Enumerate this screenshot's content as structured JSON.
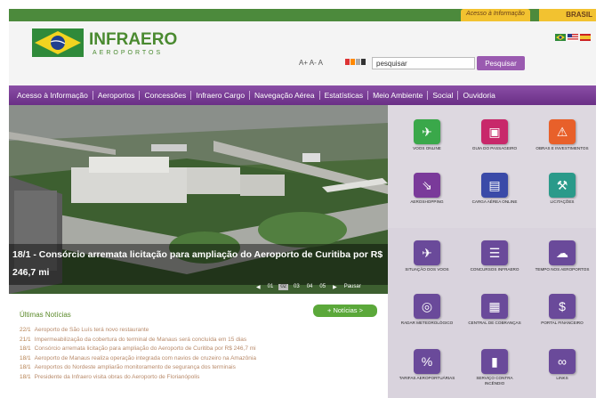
{
  "topbar": {
    "acesso_label": "Acesso à Informação",
    "brasil_label": "BRASIL"
  },
  "logo": {
    "name": "INFRAERO",
    "sub": "AEROPORTOS"
  },
  "font_controls": "A+ A- A",
  "search": {
    "value": "pesquisar",
    "button_label": "Pesquisar"
  },
  "nav": {
    "items": [
      "Acesso à Informação",
      "Aeroportos",
      "Concessões",
      "Infraero Cargo",
      "Navegação Aérea",
      "Estatísticas",
      "Meio Ambiente",
      "Social",
      "Ouvidoria"
    ]
  },
  "hero": {
    "caption": "18/1 - Consórcio arremata licitação para ampliação do Aeroporto de Curitiba por R$ 246,7 mi",
    "pager": [
      "01",
      "02",
      "03",
      "04",
      "05",
      "Pausar"
    ]
  },
  "tiles": [
    {
      "label": "Voos Online",
      "icon": "plane-icon",
      "color": "#3aa84a"
    },
    {
      "label": "Guia do Passageiro",
      "icon": "suitcase-icon",
      "color": "#c8286a"
    },
    {
      "label": "Obras e Investimentos",
      "icon": "construction-icon",
      "color": "#e8602a"
    },
    {
      "label": "Aeroshopping",
      "icon": "shopping-icon",
      "color": "#7a3a9a"
    },
    {
      "label": "Carga Aérea Online",
      "icon": "cart-icon",
      "color": "#3a4aa8"
    },
    {
      "label": "Licitações",
      "icon": "gavel-icon",
      "color": "#2a9a8a"
    },
    {
      "label": "Situação dos Voos",
      "icon": "plane-status-icon",
      "color": "#6a4a9a"
    },
    {
      "label": "Concursos Infraero",
      "icon": "document-icon",
      "color": "#6a4a9a"
    },
    {
      "label": "Tempo nos Aeroportos",
      "icon": "weather-icon",
      "color": "#6a4a9a"
    },
    {
      "label": "Radar Meteorológico",
      "icon": "radar-icon",
      "color": "#6a4a9a"
    },
    {
      "label": "Central de Cobranças",
      "icon": "money-icon",
      "color": "#6a4a9a"
    },
    {
      "label": "Portal Financeiro",
      "icon": "dollar-icon",
      "color": "#6a4a9a"
    },
    {
      "label": "Tarifas Aeroportuárias",
      "icon": "percent-icon",
      "color": "#6a4a9a"
    },
    {
      "label": "Serviço contra incêndio",
      "icon": "fire-extinguisher-icon",
      "color": "#6a4a9a"
    },
    {
      "label": "Links",
      "icon": "link-icon",
      "color": "#6a4a9a"
    }
  ],
  "news": {
    "title": "Últimas Notícias",
    "button_label": "+ Notícias >",
    "items": [
      {
        "date": "22/1",
        "text": "Aeroporto de São Luís terá novo restaurante"
      },
      {
        "date": "21/1",
        "text": "Impermeabilização da cobertura do terminal de Manaus será concluída em 15 dias"
      },
      {
        "date": "18/1",
        "text": "Consórcio arremata licitação para ampliação do Aeroporto de Curitiba por R$ 246,7 mi"
      },
      {
        "date": "18/1",
        "text": "Aeroporto de Manaus realiza operação integrada com navios de cruzeiro na Amazônia"
      },
      {
        "date": "18/1",
        "text": "Aeroportos do Nordeste ampliarão monitoramento de segurança dos terminais"
      },
      {
        "date": "18/1",
        "text": "Presidente da Infraero visita obras do Aeroporto de Florianópolis"
      }
    ]
  }
}
